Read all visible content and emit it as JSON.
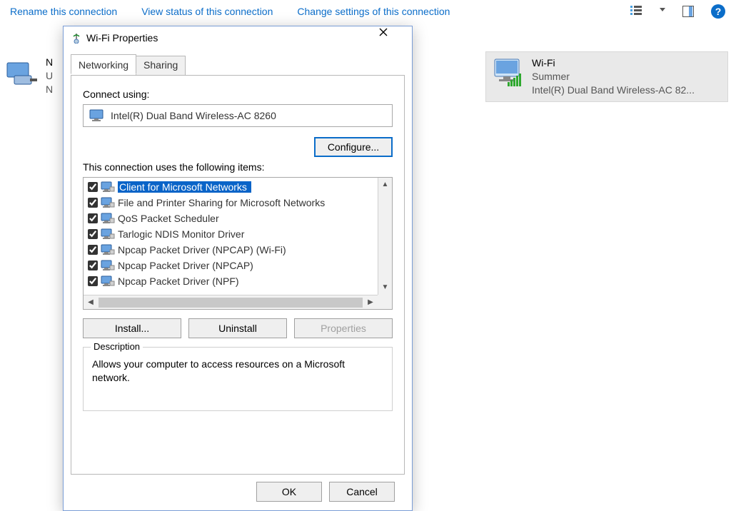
{
  "toolbar": {
    "rename": "Rename this connection",
    "view_status": "View status of this connection",
    "change_settings": "Change settings of this connection"
  },
  "left_conn": {
    "line1": "N",
    "line2": "U",
    "line3": "N"
  },
  "right_conn": {
    "name": "Wi-Fi",
    "status": "Summer",
    "adapter": "Intel(R) Dual Band Wireless-AC 82..."
  },
  "dialog": {
    "title": "Wi-Fi Properties",
    "tabs": {
      "networking": "Networking",
      "sharing": "Sharing"
    },
    "connect_using_label": "Connect using:",
    "adapter": "Intel(R) Dual Band Wireless-AC 8260",
    "configure": "Configure...",
    "items_label": "This connection uses the following items:",
    "items": [
      {
        "checked": true,
        "label": "Client for Microsoft Networks",
        "selected": true
      },
      {
        "checked": true,
        "label": "File and Printer Sharing for Microsoft Networks"
      },
      {
        "checked": true,
        "label": "QoS Packet Scheduler"
      },
      {
        "checked": true,
        "label": "Tarlogic NDIS Monitor Driver"
      },
      {
        "checked": true,
        "label": "Npcap Packet Driver (NPCAP) (Wi-Fi)"
      },
      {
        "checked": true,
        "label": "Npcap Packet Driver (NPCAP)"
      },
      {
        "checked": true,
        "label": "Npcap Packet Driver (NPF)"
      }
    ],
    "install": "Install...",
    "uninstall": "Uninstall",
    "properties": "Properties",
    "description_label": "Description",
    "description_text": "Allows your computer to access resources on a Microsoft network.",
    "ok": "OK",
    "cancel": "Cancel"
  }
}
